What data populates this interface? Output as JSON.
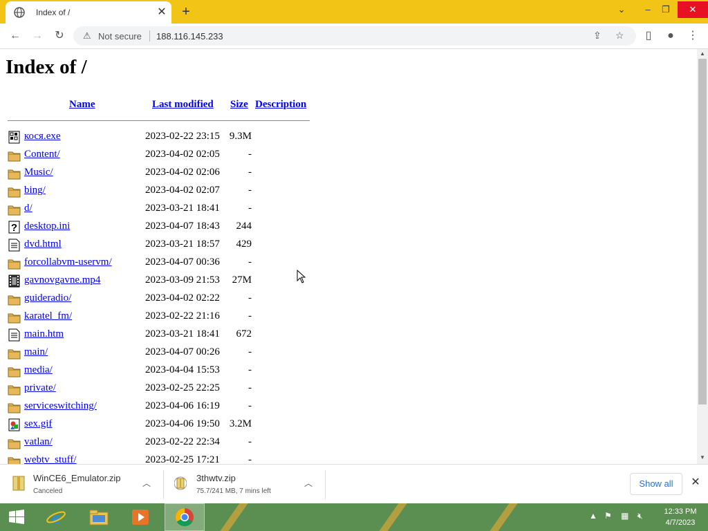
{
  "browser": {
    "tab_title": "Index of /",
    "address_status": "Not secure",
    "address_url": "188.116.145.233"
  },
  "page": {
    "heading": "Index of /",
    "columns": {
      "name": "Name",
      "modified": "Last modified",
      "size": "Size",
      "description": "Description"
    },
    "files": [
      {
        "icon": "binary-file-icon",
        "name": "кося.exe",
        "date": "2023-02-22 23:15",
        "size": "9.3M"
      },
      {
        "icon": "folder-icon",
        "name": "Content/",
        "date": "2023-04-02 02:05",
        "size": "-"
      },
      {
        "icon": "folder-icon",
        "name": "Music/",
        "date": "2023-04-02 02:06",
        "size": "-"
      },
      {
        "icon": "folder-icon",
        "name": "bing/",
        "date": "2023-04-02 02:07",
        "size": "-"
      },
      {
        "icon": "folder-icon",
        "name": "d/",
        "date": "2023-03-21 18:41",
        "size": "-"
      },
      {
        "icon": "unknown-file-icon",
        "name": "desktop.ini",
        "date": "2023-04-07 18:43",
        "size": "244"
      },
      {
        "icon": "text-file-icon",
        "name": "dvd.html",
        "date": "2023-03-21 18:57",
        "size": "429"
      },
      {
        "icon": "folder-icon",
        "name": "forcollabvm-uservm/",
        "date": "2023-04-07 00:36",
        "size": "-"
      },
      {
        "icon": "movie-file-icon",
        "name": "gavnovgavne.mp4",
        "date": "2023-03-09 21:53",
        "size": "27M"
      },
      {
        "icon": "folder-icon",
        "name": "guideradio/",
        "date": "2023-04-02 02:22",
        "size": "-"
      },
      {
        "icon": "folder-icon",
        "name": "karatel_fm/",
        "date": "2023-02-22 21:16",
        "size": "-"
      },
      {
        "icon": "text-file-icon",
        "name": "main.htm",
        "date": "2023-03-21 18:41",
        "size": "672"
      },
      {
        "icon": "folder-icon",
        "name": "main/",
        "date": "2023-04-07 00:26",
        "size": "-"
      },
      {
        "icon": "folder-icon",
        "name": "media/",
        "date": "2023-04-04 15:53",
        "size": "-"
      },
      {
        "icon": "folder-icon",
        "name": "private/",
        "date": "2023-02-25 22:25",
        "size": "-"
      },
      {
        "icon": "folder-icon",
        "name": "serviceswitching/",
        "date": "2023-04-06 16:19",
        "size": "-"
      },
      {
        "icon": "image-file-icon",
        "name": "sex.gif",
        "date": "2023-04-06 19:50",
        "size": "3.2M"
      },
      {
        "icon": "folder-icon",
        "name": "vatlan/",
        "date": "2023-02-22 22:34",
        "size": "-"
      },
      {
        "icon": "folder-icon",
        "name": "webtv_stuff/",
        "date": "2023-02-25 17:21",
        "size": "-"
      }
    ]
  },
  "downloads": {
    "items": [
      {
        "name": "WinCE6_Emulator.zip",
        "status": "Canceled"
      },
      {
        "name": "3thwtv.zip",
        "status": "75.7/241 MB, 7 mins left"
      }
    ],
    "show_all": "Show all"
  },
  "taskbar": {
    "time": "12:33 PM",
    "date": "4/7/2023"
  },
  "colors": {
    "title_bar": "#F2C416",
    "link": "#0000EE",
    "taskbar": "#5B8F51"
  }
}
